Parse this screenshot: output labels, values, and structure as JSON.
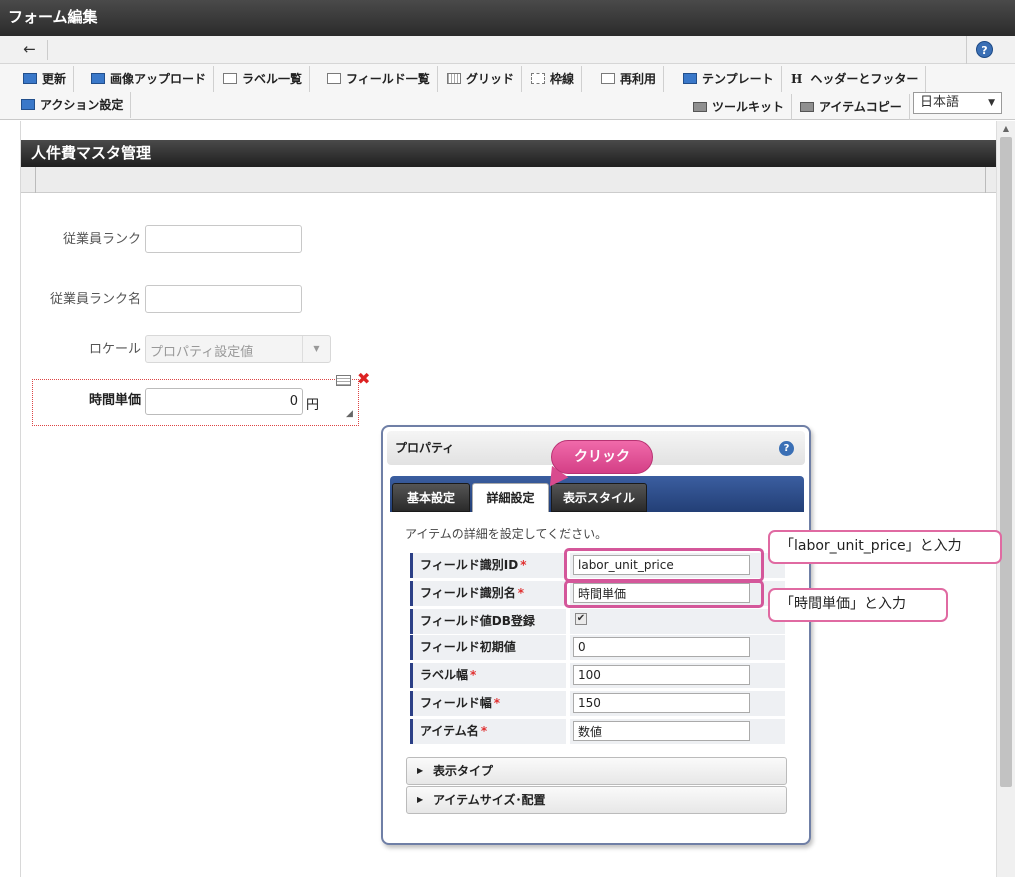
{
  "window": {
    "title": "フォーム編集"
  },
  "nav": {
    "back_icon": "←",
    "help_icon": "?"
  },
  "toolbar": {
    "items": [
      {
        "label": "更新",
        "icon": "update-icon"
      },
      {
        "label": "画像アップロード",
        "icon": "image-upload-icon"
      },
      {
        "label": "ラベル一覧",
        "icon": "label-list-icon"
      },
      {
        "label": "フィールド一覧",
        "icon": "field-list-icon"
      },
      {
        "label": "グリッド",
        "icon": "grid-icon"
      },
      {
        "label": "枠線",
        "icon": "border-icon"
      },
      {
        "label": "再利用",
        "icon": "reuse-icon"
      },
      {
        "label": "テンプレート",
        "icon": "template-icon"
      },
      {
        "label": "ヘッダーとフッター",
        "icon": "header-footer-icon"
      }
    ],
    "action_settings": "アクション設定",
    "toolkit": "ツールキット",
    "item_copy": "アイテムコピー",
    "language": "日本語",
    "header_footer_glyph": "H"
  },
  "form": {
    "title": "人件費マスタ管理",
    "employee_rank_label": "従業員ランク",
    "employee_rank_name_label": "従業員ランク名",
    "locale_label": "ロケール",
    "locale_value": "プロパティ設定値",
    "hourly_price_label": "時間単価",
    "hourly_price_value": "0",
    "hourly_price_unit": "円"
  },
  "properties": {
    "title": "プロパティ",
    "tabs": [
      "基本設定",
      "詳細設定",
      "表示スタイル"
    ],
    "active_tab": "詳細設定",
    "description": "アイテムの詳細を設定してください。",
    "rows": [
      {
        "label": "フィールド識別ID",
        "required": "*",
        "value": "labor_unit_price"
      },
      {
        "label": "フィールド識別名",
        "required": "*",
        "value": "時間単価"
      },
      {
        "label": "フィールド値DB登録",
        "required": "",
        "checked": "✔"
      },
      {
        "label": "フィールド初期値",
        "required": "",
        "value": "0"
      },
      {
        "label": "ラベル幅",
        "required": "*",
        "value": "100"
      },
      {
        "label": "フィールド幅",
        "required": "*",
        "value": "150"
      },
      {
        "label": "アイテム名",
        "required": "*",
        "value": "数値"
      }
    ],
    "sections": [
      "表示タイプ",
      "アイテムサイズ･配置"
    ]
  },
  "annotations": {
    "click": "クリック",
    "callout_id": "「labor_unit_price」と入力",
    "callout_name": "「時間単価」と入力"
  },
  "colors": {
    "accent": "#2b3f86",
    "callout": "#e06aa2",
    "error": "#d22222"
  }
}
